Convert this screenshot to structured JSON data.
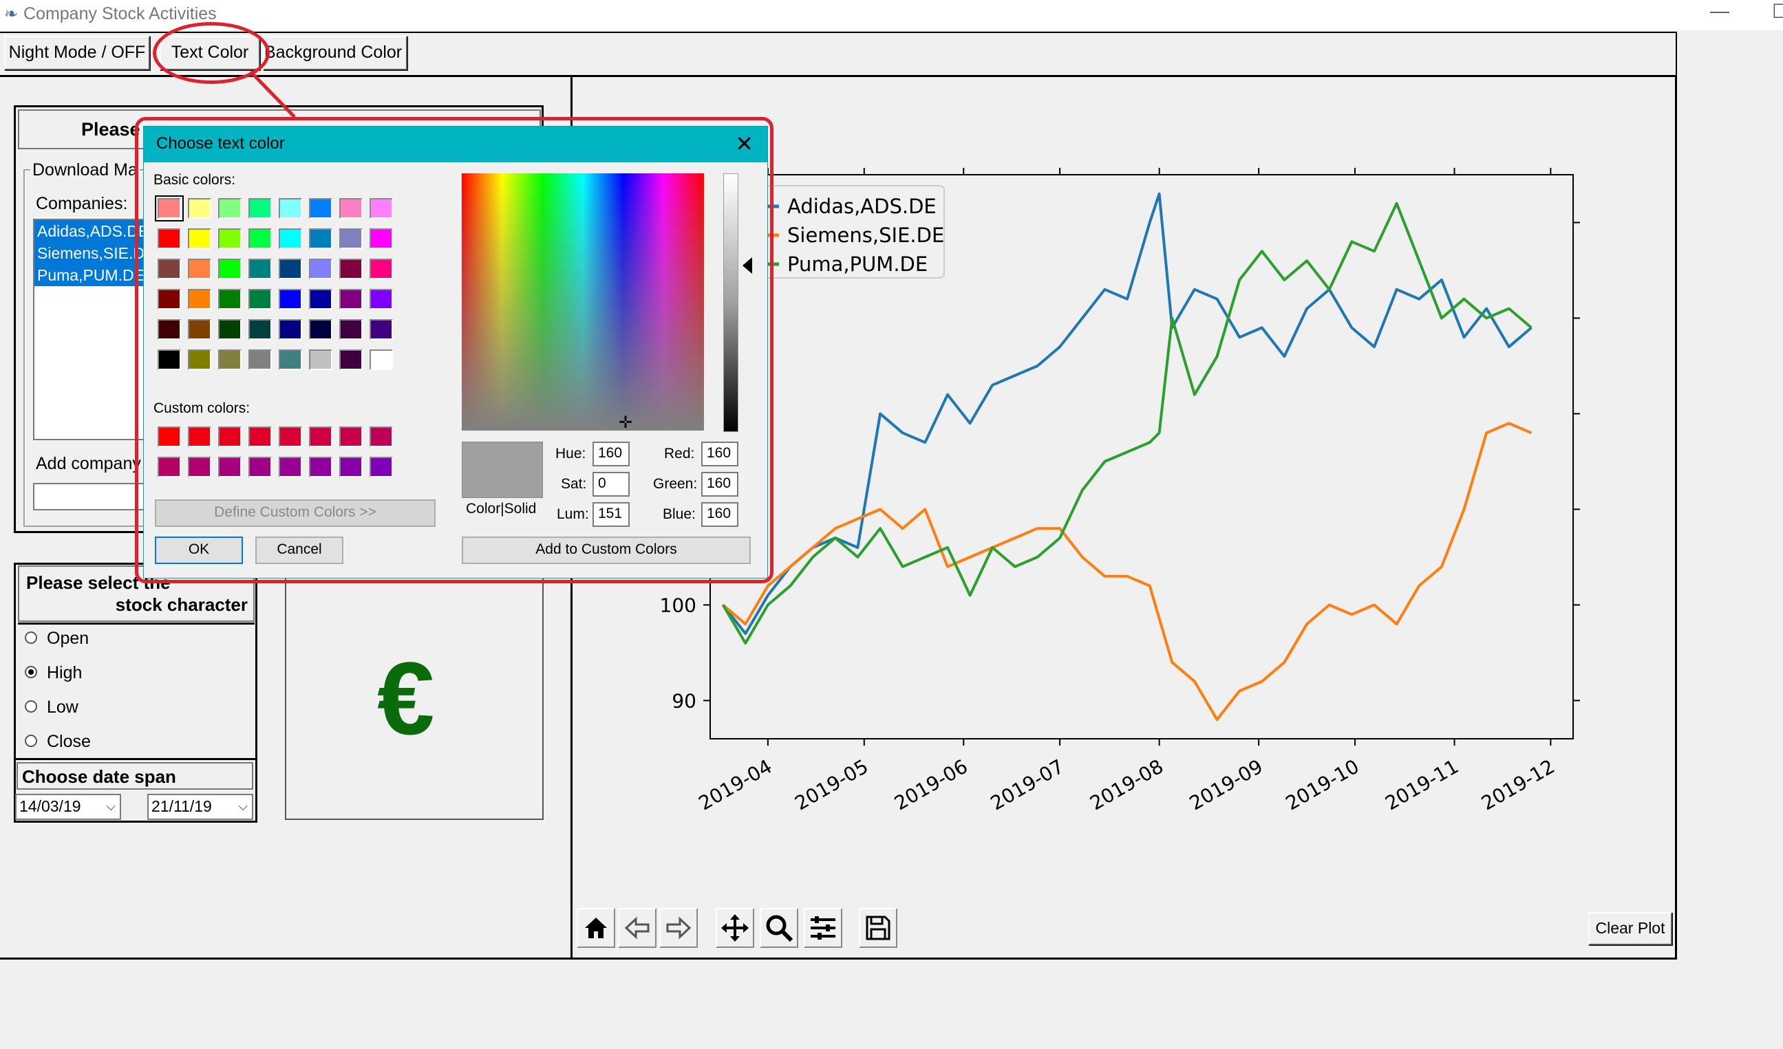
{
  "window": {
    "title": "Company Stock Activities",
    "min_glyph": "—",
    "max_glyph": "☐"
  },
  "toolbar": {
    "night_mode": "Night Mode / OFF",
    "text_color": "Text Color",
    "background_color": "Background Color"
  },
  "left_panel": {
    "please_header": "Please",
    "download_group": "Download Ma",
    "companies_label": "Companies:",
    "companies": [
      "Adidas,ADS.DE",
      "Siemens,SIE.DE",
      "Puma,PUM.DE"
    ],
    "add_company_label": "Add company",
    "add_company_value": "",
    "stock_header_line1": "Please select the",
    "stock_header_line2": "stock character",
    "characters": [
      {
        "label": "Open",
        "selected": false
      },
      {
        "label": "High",
        "selected": true
      },
      {
        "label": "Low",
        "selected": false
      },
      {
        "label": "Close",
        "selected": false
      }
    ],
    "date_span_label": "Choose date span",
    "date_from": "14/03/19",
    "date_to": "21/11/19",
    "currency_symbol": "€",
    "currency_color": "#0a6b0a"
  },
  "plot_toolbar": {
    "icons": [
      "home-icon",
      "back-arrow-icon",
      "forward-arrow-icon",
      "pan-icon",
      "zoom-icon",
      "configure-icon",
      "save-icon"
    ],
    "clear_plot": "Clear Plot"
  },
  "dialog": {
    "title": "Choose text color",
    "close_glyph": "✕",
    "basic_colors_label": "Basic colors:",
    "basic_colors": [
      [
        "#ff8080",
        "#ffff80",
        "#80ff80",
        "#00ff80",
        "#80ffff",
        "#0080ff",
        "#ff80c0",
        "#ff80ff"
      ],
      [
        "#ff0000",
        "#ffff00",
        "#80ff00",
        "#00ff40",
        "#00ffff",
        "#0080c0",
        "#8080c0",
        "#ff00ff"
      ],
      [
        "#804040",
        "#ff8040",
        "#00ff00",
        "#008080",
        "#004080",
        "#8080ff",
        "#800040",
        "#ff0080"
      ],
      [
        "#800000",
        "#ff8000",
        "#008000",
        "#008040",
        "#0000ff",
        "#0000a0",
        "#800080",
        "#8000ff"
      ],
      [
        "#400000",
        "#804000",
        "#004000",
        "#004040",
        "#000080",
        "#000040",
        "#400040",
        "#400080"
      ],
      [
        "#000000",
        "#808000",
        "#808040",
        "#808080",
        "#408080",
        "#c0c0c0",
        "#400040",
        "#ffffff"
      ]
    ],
    "custom_colors_label": "Custom colors:",
    "custom_colors": [
      [
        "#ff0000",
        "#f00010",
        "#e8001c",
        "#e00028",
        "#d80034",
        "#d00040",
        "#c8004c",
        "#c00058"
      ],
      [
        "#b80064",
        "#b00070",
        "#a8007c",
        "#a00088",
        "#980094",
        "#9000a0",
        "#8800ac",
        "#8000b8"
      ]
    ],
    "define_custom": "Define Custom Colors >>",
    "ok": "OK",
    "cancel": "Cancel",
    "preview_color": "#a0a0a0",
    "color_solid_label": "Color|Solid",
    "hue_label": "Hue:",
    "hue": "160",
    "sat_label": "Sat:",
    "sat": "0",
    "lum_label": "Lum:",
    "lum": "151",
    "red_label": "Red:",
    "red": "160",
    "green_label": "Green:",
    "green": "160",
    "blue_label": "Blue:",
    "blue": "160",
    "add_custom": "Add to Custom Colors"
  },
  "chart_data": {
    "type": "line",
    "x_ticks": [
      "2019-04",
      "2019-05",
      "2019-06",
      "2019-07",
      "2019-08",
      "2019-09",
      "2019-10",
      "2019-11",
      "2019-12"
    ],
    "y_ticks": [
      90,
      100
    ],
    "ylim": [
      86,
      145
    ],
    "x_range": [
      "2019-03-14",
      "2019-12-08"
    ],
    "legend_position": "upper-left",
    "series": [
      {
        "name": "Adidas,ADS.DE",
        "color": "#1f77b4",
        "points": [
          [
            "2019-03-18",
            100
          ],
          [
            "2019-03-25",
            97
          ],
          [
            "2019-04-01",
            101
          ],
          [
            "2019-04-08",
            104
          ],
          [
            "2019-04-15",
            106
          ],
          [
            "2019-04-22",
            107
          ],
          [
            "2019-04-29",
            106
          ],
          [
            "2019-05-06",
            120
          ],
          [
            "2019-05-13",
            118
          ],
          [
            "2019-05-20",
            117
          ],
          [
            "2019-05-27",
            122
          ],
          [
            "2019-06-03",
            119
          ],
          [
            "2019-06-10",
            123
          ],
          [
            "2019-06-17",
            124
          ],
          [
            "2019-06-24",
            125
          ],
          [
            "2019-07-01",
            127
          ],
          [
            "2019-07-08",
            130
          ],
          [
            "2019-07-15",
            133
          ],
          [
            "2019-07-22",
            132
          ],
          [
            "2019-07-29",
            140
          ],
          [
            "2019-08-01",
            143
          ],
          [
            "2019-08-05",
            129
          ],
          [
            "2019-08-12",
            133
          ],
          [
            "2019-08-19",
            132
          ],
          [
            "2019-08-26",
            128
          ],
          [
            "2019-09-02",
            129
          ],
          [
            "2019-09-09",
            126
          ],
          [
            "2019-09-16",
            131
          ],
          [
            "2019-09-23",
            133
          ],
          [
            "2019-09-30",
            129
          ],
          [
            "2019-10-07",
            127
          ],
          [
            "2019-10-14",
            133
          ],
          [
            "2019-10-21",
            132
          ],
          [
            "2019-10-28",
            134
          ],
          [
            "2019-11-04",
            128
          ],
          [
            "2019-11-11",
            131
          ],
          [
            "2019-11-18",
            127
          ],
          [
            "2019-11-25",
            129
          ]
        ]
      },
      {
        "name": "Siemens,SIE.DE",
        "color": "#ff7f0e",
        "points": [
          [
            "2019-03-18",
            100
          ],
          [
            "2019-03-25",
            98
          ],
          [
            "2019-04-01",
            102
          ],
          [
            "2019-04-08",
            104
          ],
          [
            "2019-04-15",
            106
          ],
          [
            "2019-04-22",
            108
          ],
          [
            "2019-04-29",
            109
          ],
          [
            "2019-05-06",
            110
          ],
          [
            "2019-05-13",
            108
          ],
          [
            "2019-05-20",
            110
          ],
          [
            "2019-05-27",
            104
          ],
          [
            "2019-06-03",
            105
          ],
          [
            "2019-06-10",
            106
          ],
          [
            "2019-06-17",
            107
          ],
          [
            "2019-06-24",
            108
          ],
          [
            "2019-07-01",
            108
          ],
          [
            "2019-07-08",
            105
          ],
          [
            "2019-07-15",
            103
          ],
          [
            "2019-07-22",
            103
          ],
          [
            "2019-07-29",
            102
          ],
          [
            "2019-08-05",
            94
          ],
          [
            "2019-08-12",
            92
          ],
          [
            "2019-08-19",
            88
          ],
          [
            "2019-08-26",
            91
          ],
          [
            "2019-09-02",
            92
          ],
          [
            "2019-09-09",
            94
          ],
          [
            "2019-09-16",
            98
          ],
          [
            "2019-09-23",
            100
          ],
          [
            "2019-09-30",
            99
          ],
          [
            "2019-10-07",
            100
          ],
          [
            "2019-10-14",
            98
          ],
          [
            "2019-10-21",
            102
          ],
          [
            "2019-10-28",
            104
          ],
          [
            "2019-11-04",
            110
          ],
          [
            "2019-11-11",
            118
          ],
          [
            "2019-11-18",
            119
          ],
          [
            "2019-11-25",
            118
          ]
        ]
      },
      {
        "name": "Puma,PUM.DE",
        "color": "#2ca02c",
        "points": [
          [
            "2019-03-18",
            100
          ],
          [
            "2019-03-25",
            96
          ],
          [
            "2019-04-01",
            100
          ],
          [
            "2019-04-08",
            102
          ],
          [
            "2019-04-15",
            105
          ],
          [
            "2019-04-22",
            107
          ],
          [
            "2019-04-29",
            105
          ],
          [
            "2019-05-06",
            108
          ],
          [
            "2019-05-13",
            104
          ],
          [
            "2019-05-20",
            105
          ],
          [
            "2019-05-27",
            106
          ],
          [
            "2019-06-03",
            101
          ],
          [
            "2019-06-10",
            106
          ],
          [
            "2019-06-17",
            104
          ],
          [
            "2019-06-24",
            105
          ],
          [
            "2019-07-01",
            107
          ],
          [
            "2019-07-08",
            112
          ],
          [
            "2019-07-15",
            115
          ],
          [
            "2019-07-22",
            116
          ],
          [
            "2019-07-29",
            117
          ],
          [
            "2019-08-01",
            118
          ],
          [
            "2019-08-05",
            130
          ],
          [
            "2019-08-12",
            122
          ],
          [
            "2019-08-19",
            126
          ],
          [
            "2019-08-26",
            134
          ],
          [
            "2019-09-02",
            137
          ],
          [
            "2019-09-09",
            134
          ],
          [
            "2019-09-16",
            136
          ],
          [
            "2019-09-23",
            133
          ],
          [
            "2019-09-30",
            138
          ],
          [
            "2019-10-07",
            137
          ],
          [
            "2019-10-14",
            142
          ],
          [
            "2019-10-21",
            136
          ],
          [
            "2019-10-28",
            130
          ],
          [
            "2019-11-04",
            132
          ],
          [
            "2019-11-11",
            130
          ],
          [
            "2019-11-18",
            131
          ],
          [
            "2019-11-25",
            129
          ]
        ]
      }
    ]
  }
}
